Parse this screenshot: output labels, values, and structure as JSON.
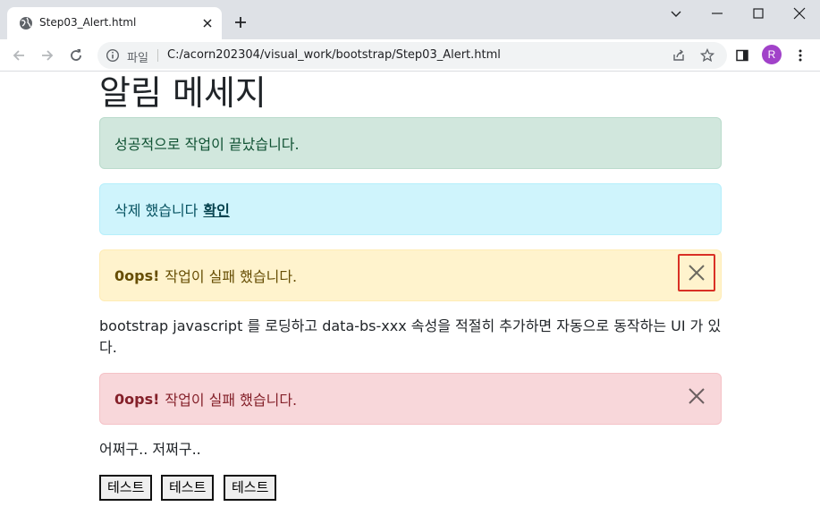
{
  "browser": {
    "tab_title": "Step03_Alert.html",
    "scheme_label": "파일",
    "url": "C:/acorn202304/visual_work/bootstrap/Step03_Alert.html",
    "profile_initial": "R"
  },
  "page": {
    "heading": "알림 메세지",
    "alert_success": {
      "text": "성공적으로 작업이 끝났습니다."
    },
    "alert_info": {
      "text": "삭제 했습니다",
      "link": "확인"
    },
    "alert_warning": {
      "strong": "0ops!",
      "text": "작업이 실패 했습니다."
    },
    "paragraph": "bootstrap javascript 를 로딩하고 data-bs-xxx 속성을 적절히 추가하면 자동으로 동작하는 UI 가 있다.",
    "alert_danger": {
      "strong": "0ops!",
      "text": "작업이 실패 했습니다."
    },
    "paragraph2": "어쩌구.. 저쩌구..",
    "buttons": [
      "테스트",
      "테스트",
      "테스트"
    ]
  }
}
